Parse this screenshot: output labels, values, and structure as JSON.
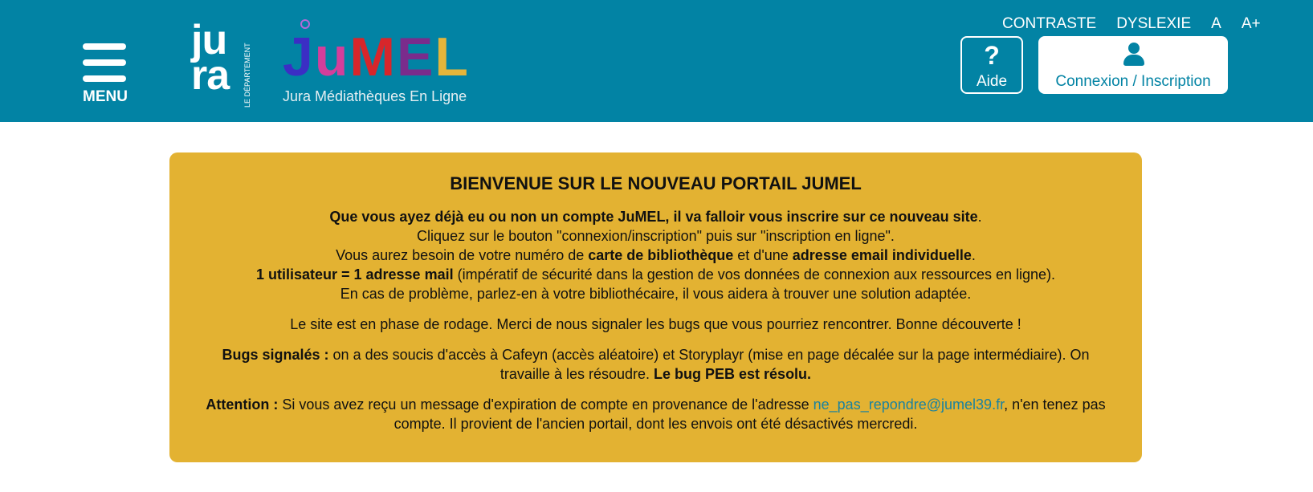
{
  "header": {
    "menu_label": "MENU",
    "jura_logo": {
      "text_top": "ju",
      "text_bottom": "ra",
      "subtitle": "LE DÉPARTEMENT"
    },
    "jumel_logo": {
      "letters": [
        "J",
        "u",
        "M",
        "E",
        "L"
      ],
      "letter_colors": [
        "#3b2ec4",
        "#d43e9b",
        "#d7262b",
        "#7a2c8c",
        "#e5b53a"
      ],
      "tagline": "Jura Médiathèques En Ligne"
    },
    "top_links": [
      "CONTRASTE",
      "DYSLEXIE",
      "A",
      "A+"
    ],
    "help_label": "Aide",
    "help_icon": "question-mark-icon",
    "login_label": "Connexion / Inscription",
    "login_icon": "user-icon"
  },
  "notice": {
    "title": "BIENVENUE SUR LE NOUVEAU PORTAIL JUMEL",
    "line1_bold": "Que vous ayez déjà eu ou non un compte JuMEL, il va falloir vous inscrire sur ce nouveau site",
    "line1_end": ".",
    "line2": "Cliquez sur le bouton \"connexion/inscription\" puis sur \"inscription en ligne\".",
    "line3_a": "Vous aurez besoin de votre numéro de ",
    "line3_b": "carte de bibliothèque",
    "line3_c": " et d'une ",
    "line3_d": "adresse email individuelle",
    "line3_e": ".",
    "line4_bold": "1 utilisateur = 1 adresse mail",
    "line4_rest": " (impératif de sécurité dans la gestion de vos données de connexion aux ressources en ligne).",
    "line5": "En cas de problème, parlez-en à votre bibliothécaire, il vous aidera à trouver une solution adaptée.",
    "para2": "Le site est en phase de rodage. Merci de nous signaler les bugs que vous pourriez rencontrer. Bonne découverte !",
    "bugs_label": "Bugs signalés : ",
    "bugs_text": " on a des soucis d'accès à Cafeyn (accès aléatoire) et Storyplayr (mise en page décalée sur la page intermédiaire). On travaille à les résoudre. ",
    "bugs_bold": "Le bug PEB est résolu.",
    "attention_label": "Attention : ",
    "attention_text": "Si vous avez reçu un message d'expiration de compte en provenance de l'adresse ",
    "attention_email": "ne_pas_repondre@jumel39.fr",
    "attention_end": ", n'en tenez pas compte. Il provient de l'ancien portail, dont les envois ont été désactivés mercredi."
  },
  "colors": {
    "header_bg": "#0283a4",
    "notice_bg": "#e3b232",
    "link": "#1a82a0"
  }
}
